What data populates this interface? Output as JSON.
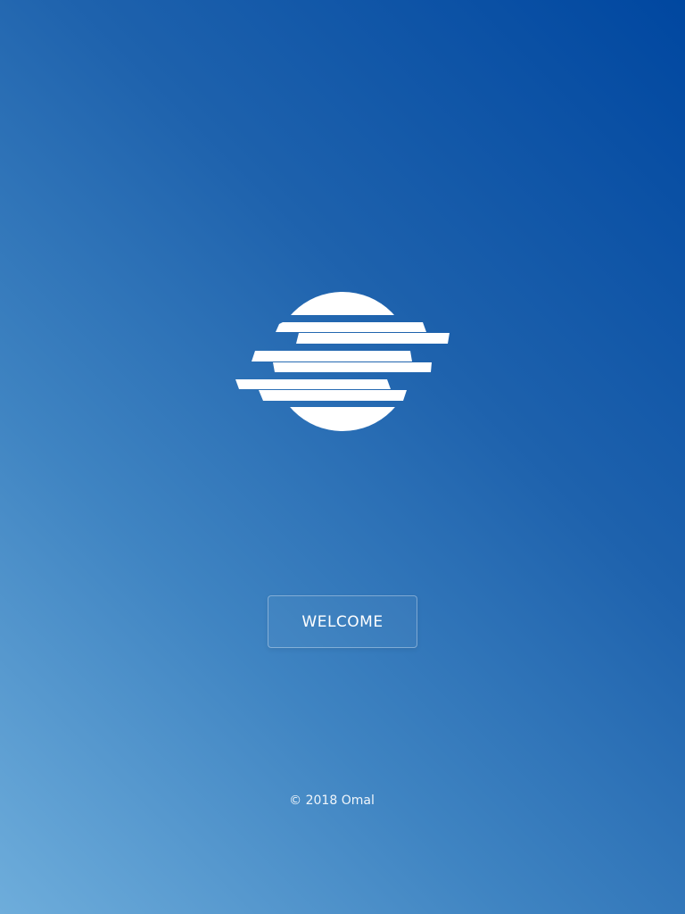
{
  "logo": {
    "icon": "striped-sun-logo",
    "color": "#ffffff"
  },
  "welcome": {
    "label": "WELCOME"
  },
  "footer": {
    "copyright": "© 2018 Omal"
  },
  "colors": {
    "gradient_light": "#6eaddb",
    "gradient_mid": "#1e62ad",
    "gradient_dark": "#0047a0",
    "text": "#ffffff"
  }
}
